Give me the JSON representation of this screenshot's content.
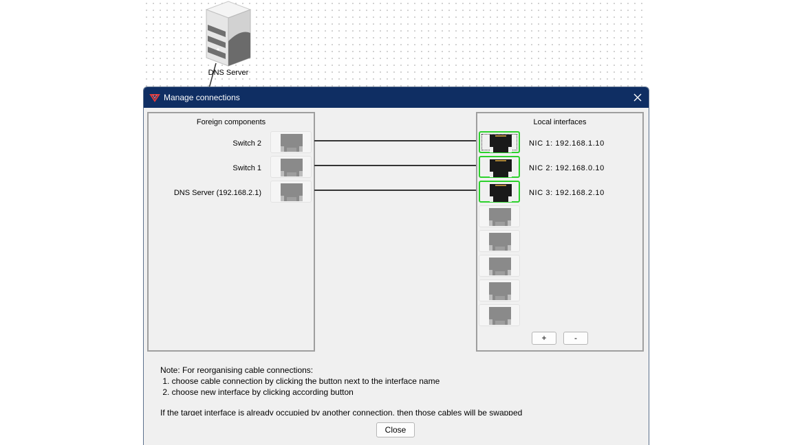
{
  "canvas": {
    "node_label": "DNS Server"
  },
  "dialog": {
    "title": "Manage connections",
    "foreign_panel_title": "Foreign components",
    "local_panel_title": "Local interfaces",
    "foreign_components": [
      {
        "label": "Switch 2"
      },
      {
        "label": "Switch 1"
      },
      {
        "label": "DNS Server (192.168.2.1)"
      }
    ],
    "local_interfaces": [
      {
        "label": "NIC 1: 192.168.1.10",
        "connected": true
      },
      {
        "label": "NIC 2: 192.168.0.10",
        "connected": true
      },
      {
        "label": "NIC 3: 192.168.2.10",
        "connected": true
      },
      {
        "label": "",
        "connected": false
      },
      {
        "label": "",
        "connected": false
      },
      {
        "label": "",
        "connected": false
      },
      {
        "label": "",
        "connected": false
      },
      {
        "label": "",
        "connected": false
      }
    ],
    "add_label": "+",
    "remove_label": "-",
    "note": {
      "heading": "Note: For reorganising cable connections:",
      "step1": " 1. choose cable connection by clicking the button next to the interface name",
      "step2": " 2. choose new interface by clicking according button",
      "footer": "If the target interface is already occupied by another connection, then those cables will be swapped"
    },
    "close_label": "Close"
  },
  "colors": {
    "titlebar": "#0f2e63",
    "active_port_border": "#2bd12b",
    "cable": "#333333"
  },
  "icons": [
    "server-icon",
    "app-icon",
    "close-icon",
    "ethernet-port-icon"
  ]
}
